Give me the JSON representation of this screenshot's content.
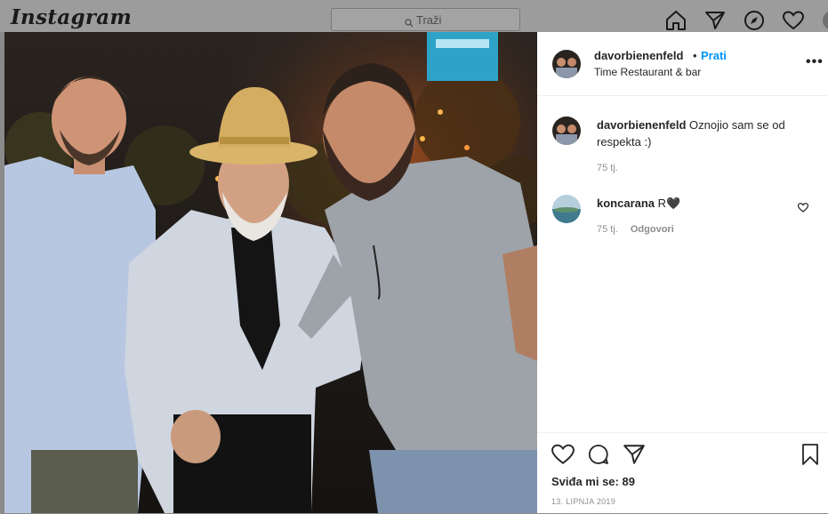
{
  "app": {
    "logo_text": "Instagram"
  },
  "search": {
    "placeholder": "Traži"
  },
  "nav": {
    "icons": [
      "home-icon",
      "direct-icon",
      "explore-icon",
      "activity-heart-icon",
      "profile-avatar"
    ]
  },
  "post": {
    "author": "davorbienenfeld",
    "separator": "•",
    "follow_label": "Prati",
    "location": "Time Restaurant & bar",
    "more_label": "•••",
    "caption": {
      "username": "davorbienenfeld",
      "text": "Oznojio sam se od respekta :)",
      "time": "75 tj."
    },
    "comments": [
      {
        "username": "koncarana",
        "text": "R🖤",
        "time": "75 tj.",
        "reply_label": "Odgovori"
      }
    ],
    "likes_label": "Sviđa mi se: 89",
    "date": "13. LIPNJA 2019"
  },
  "colors": {
    "follow_blue": "#0095f6",
    "muted_gray": "#8e8e8e",
    "text": "#262626"
  }
}
